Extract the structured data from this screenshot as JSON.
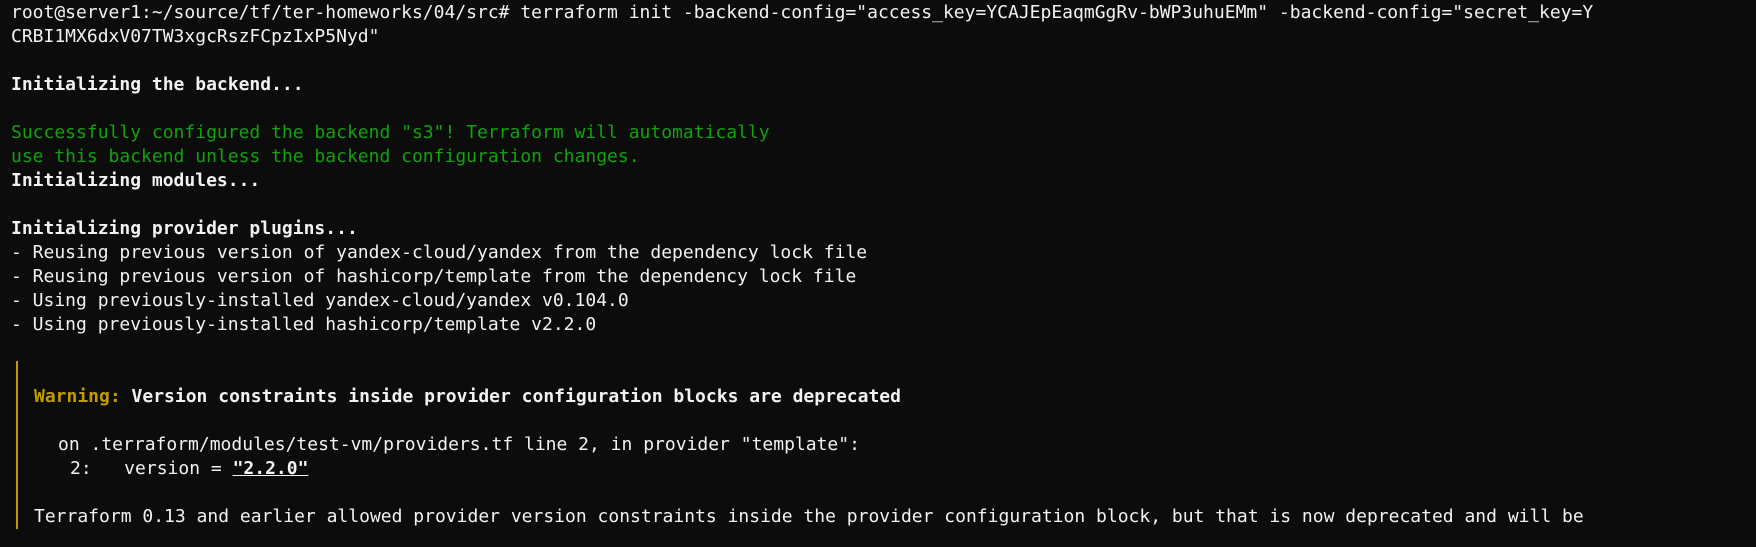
{
  "terminal": {
    "command_line_1": "root@server1:~/source/tf/ter-homeworks/04/src# terraform init -backend-config=\"access_key=YCAJEpEaqmGgRv-bWP3uhuEMm\" -backend-config=\"secret_key=Y",
    "command_line_2": "CRBI1MX6dxV07TW3xgcRszFCpzIxP5Nyd\"",
    "init_backend": "Initializing the backend...",
    "success_line_1": "Successfully configured the backend \"s3\"! Terraform will automatically",
    "success_line_2": "use this backend unless the backend configuration changes.",
    "init_modules": "Initializing modules...",
    "init_plugins": "Initializing provider plugins...",
    "plugin_lines": [
      "- Reusing previous version of yandex-cloud/yandex from the dependency lock file",
      "- Reusing previous version of hashicorp/template from the dependency lock file",
      "- Using previously-installed yandex-cloud/yandex v0.104.0",
      "- Using previously-installed hashicorp/template v2.2.0"
    ],
    "warning": {
      "label": "Warning:",
      "message": " Version constraints inside provider configuration blocks are deprecated",
      "location": "on .terraform/modules/test-vm/providers.tf line 2, in provider \"template\":",
      "code_prefix": "2:   version = ",
      "code_value": "\"2.2.0\"",
      "detail": "Terraform 0.13 and earlier allowed provider version constraints inside the provider configuration block, but that is now deprecated and will be"
    }
  }
}
